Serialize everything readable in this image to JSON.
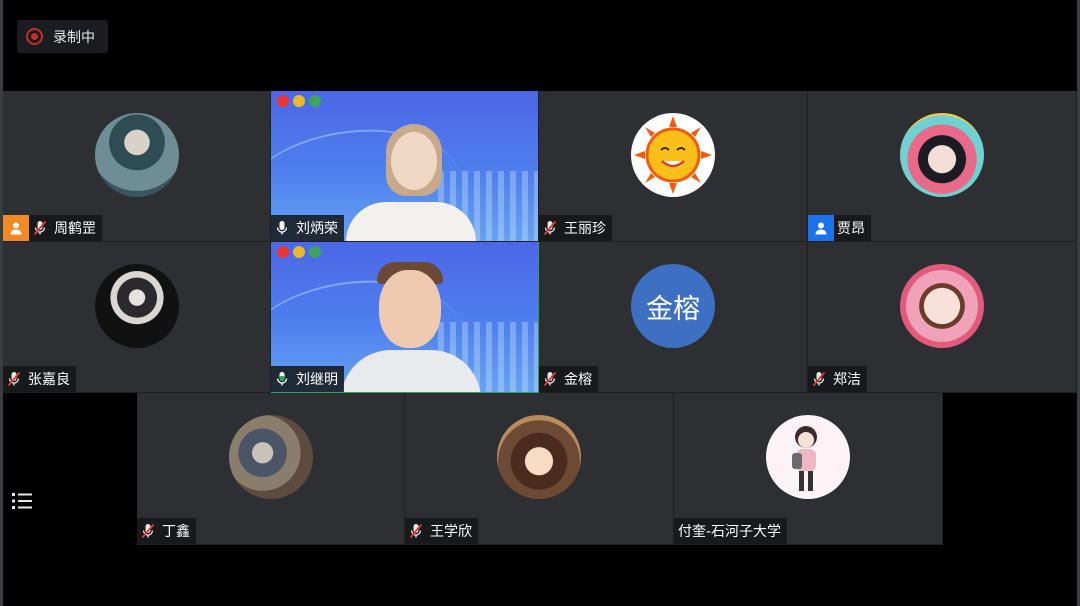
{
  "recording": {
    "label": "录制中"
  },
  "participants": [
    {
      "name": "周鹤罡",
      "mic": "muted",
      "badge": "user-orange"
    },
    {
      "name": "刘炳荣",
      "mic": "on",
      "video": true
    },
    {
      "name": "王丽珍",
      "mic": "muted"
    },
    {
      "name": "贾昂",
      "badge": "user-blue"
    },
    {
      "name": "张嘉良",
      "mic": "muted"
    },
    {
      "name": "刘继明",
      "mic": "speaking",
      "video": true,
      "active": true
    },
    {
      "name": "金榕",
      "mic": "muted",
      "avatar_text": "金榕"
    },
    {
      "name": "郑洁",
      "mic": "muted"
    },
    {
      "name": "丁鑫",
      "mic": "muted"
    },
    {
      "name": "王学欣",
      "mic": "muted"
    },
    {
      "name": "付奎-石河子大学"
    }
  ],
  "colors": {
    "tile": "#2d2f33",
    "record": "#c0302b",
    "speaking": "#29a35a",
    "badge_orange": "#f08a24",
    "badge_blue": "#1a73e8",
    "avatar_text_bg": "#3d6fc2"
  },
  "icons": {
    "record": "record-icon",
    "mic_muted": "mic-muted-icon",
    "mic_on": "mic-icon",
    "menu": "list-menu-icon",
    "user": "user-icon"
  }
}
